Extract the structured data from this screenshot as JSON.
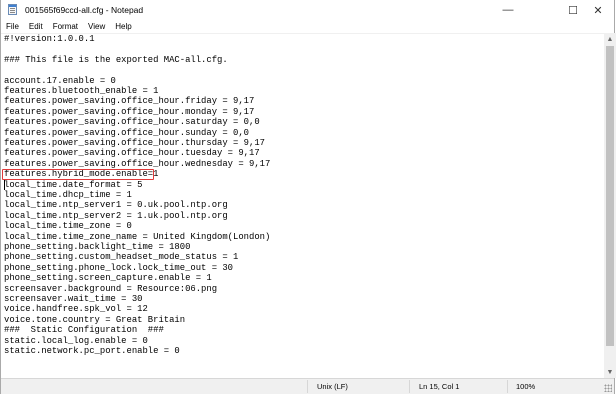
{
  "window": {
    "title": "001565f69ccd-all.cfg - Notepad",
    "controls": {
      "minimize": "—",
      "maximize": "☐",
      "close": "✕"
    }
  },
  "menu": [
    "File",
    "Edit",
    "Format",
    "View",
    "Help"
  ],
  "editor": {
    "lines": [
      "#!version:1.0.0.1",
      "",
      "### This file is the exported MAC-all.cfg.",
      "",
      "account.17.enable = 0",
      "features.bluetooth_enable = 1",
      "features.power_saving.office_hour.friday = 9,17",
      "features.power_saving.office_hour.monday = 9,17",
      "features.power_saving.office_hour.saturday = 0,0",
      "features.power_saving.office_hour.sunday = 0,0",
      "features.power_saving.office_hour.thursday = 9,17",
      "features.power_saving.office_hour.tuesday = 9,17",
      "features.power_saving.office_hour.wednesday = 9,17",
      "features.hybrid_mode.enable=1",
      "local_time.date_format = 5",
      "local_time.dhcp_time = 1",
      "local_time.ntp_server1 = 0.uk.pool.ntp.org",
      "local_time.ntp_server2 = 1.uk.pool.ntp.org",
      "local_time.time_zone = 0",
      "local_time.time_zone_name = United Kingdom(London)",
      "phone_setting.backlight_time = 1800",
      "phone_setting.custom_headset_mode_status = 1",
      "phone_setting.phone_lock.lock_time_out = 30",
      "phone_setting.screen_capture.enable = 1",
      "screensaver.background = Resource:06.png",
      "screensaver.wait_time = 30",
      "voice.handfree.spk_vol = 12",
      "voice.tone.country = Great Britain",
      "###  Static Configuration  ###",
      "static.local_log.enable = 0",
      "static.network.pc_port.enable = 0"
    ]
  },
  "status": {
    "encoding": "Unix (LF)",
    "position": "Ln 15, Col 1",
    "zoom": "100%"
  },
  "icons": {
    "app": "notepad-icon",
    "scroll_up": "scroll-up-arrow-icon",
    "scroll_down": "scroll-down-arrow-icon"
  }
}
